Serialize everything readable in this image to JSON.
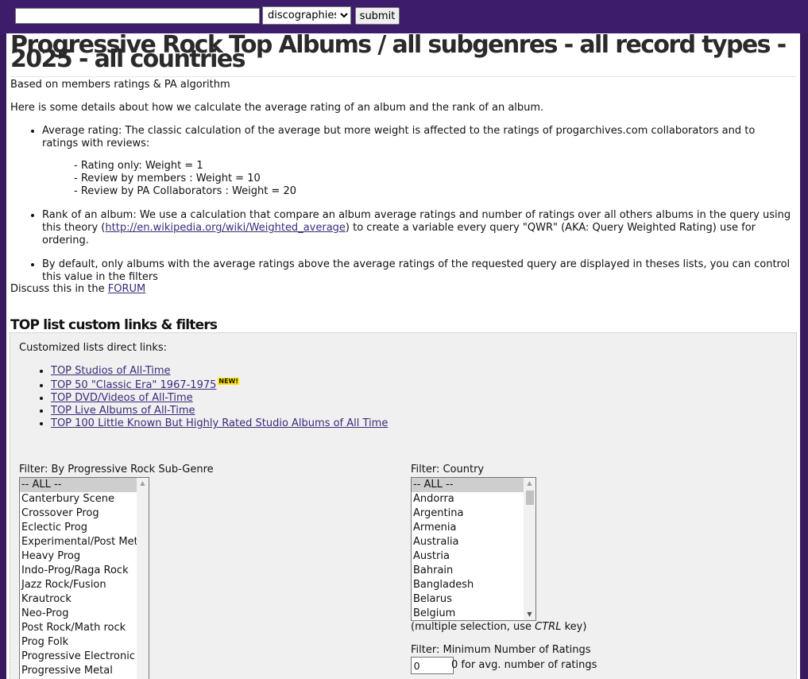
{
  "search": {
    "value": "",
    "category": "discographies",
    "submit_label": "submit"
  },
  "page": {
    "title": "Progressive Rock Top Albums / all subgenres - all record types - 2025 - all countries",
    "subtitle": "Based on members ratings & PA algorithm",
    "intro": "Here is some details about how we calculate the average rating of an album and the rank of an album.",
    "bullet1": "Average rating: The classic calculation of the average but more weight is affected to the ratings of progarchives.com collaborators and to ratings with reviews:",
    "weights": [
      "- Rating only: Weight = 1",
      "- Review by members : Weight = 10",
      "- Review by PA Collaborators : Weight = 20"
    ],
    "bullet2_pre": "Rank of an album: We use a calculation that compare an album average ratings and number of ratings over all others albums in the query using this theory (",
    "bullet2_link": "http://en.wikipedia.org/wiki/Weighted_average",
    "bullet2_post": ") to create a variable every query \"QWR\" (AKA: Query Weighted Rating) use for ordering.",
    "bullet3": "By default, only albums with the average ratings above the average ratings of the requested query are displayed in theses lists, you can control this value in the filters",
    "discuss_pre": "Discuss this in the ",
    "discuss_link": "FORUM"
  },
  "filters": {
    "heading": "TOP list custom links & filters",
    "direct_title": "Customized lists direct links:",
    "links": [
      "TOP Studios of All-Time",
      "TOP 50 \"Classic Era\" 1967-1975",
      "TOP DVD/Videos of All-Time",
      "TOP Live Albums of All-Time",
      "TOP 100 Little Known But Highly Rated Studio Albums of All Time"
    ],
    "new_badge": "NEW!",
    "subgenre_label": "Filter: By Progressive Rock Sub-Genre",
    "subgenres": [
      "-- ALL --",
      "Canterbury Scene",
      "Crossover Prog",
      "Eclectic Prog",
      "Experimental/Post Metal",
      "Heavy Prog",
      "Indo-Prog/Raga Rock",
      "Jazz Rock/Fusion",
      "Krautrock",
      "Neo-Prog",
      "Post Rock/Math rock",
      "Prog Folk",
      "Progressive Electronic",
      "Progressive Metal"
    ],
    "country_label": "Filter: Country",
    "countries": [
      "-- ALL --",
      "Andorra",
      "Argentina",
      "Armenia",
      "Australia",
      "Austria",
      "Bahrain",
      "Bangladesh",
      "Belarus",
      "Belgium"
    ],
    "multi_note_pre": "(multiple selection, use ",
    "multi_note_key": "CTRL",
    "multi_note_post": " key)",
    "min_label": "Filter: Minimum Number of Ratings",
    "min_value": "0",
    "min_note": "0 for avg. number of ratings"
  }
}
